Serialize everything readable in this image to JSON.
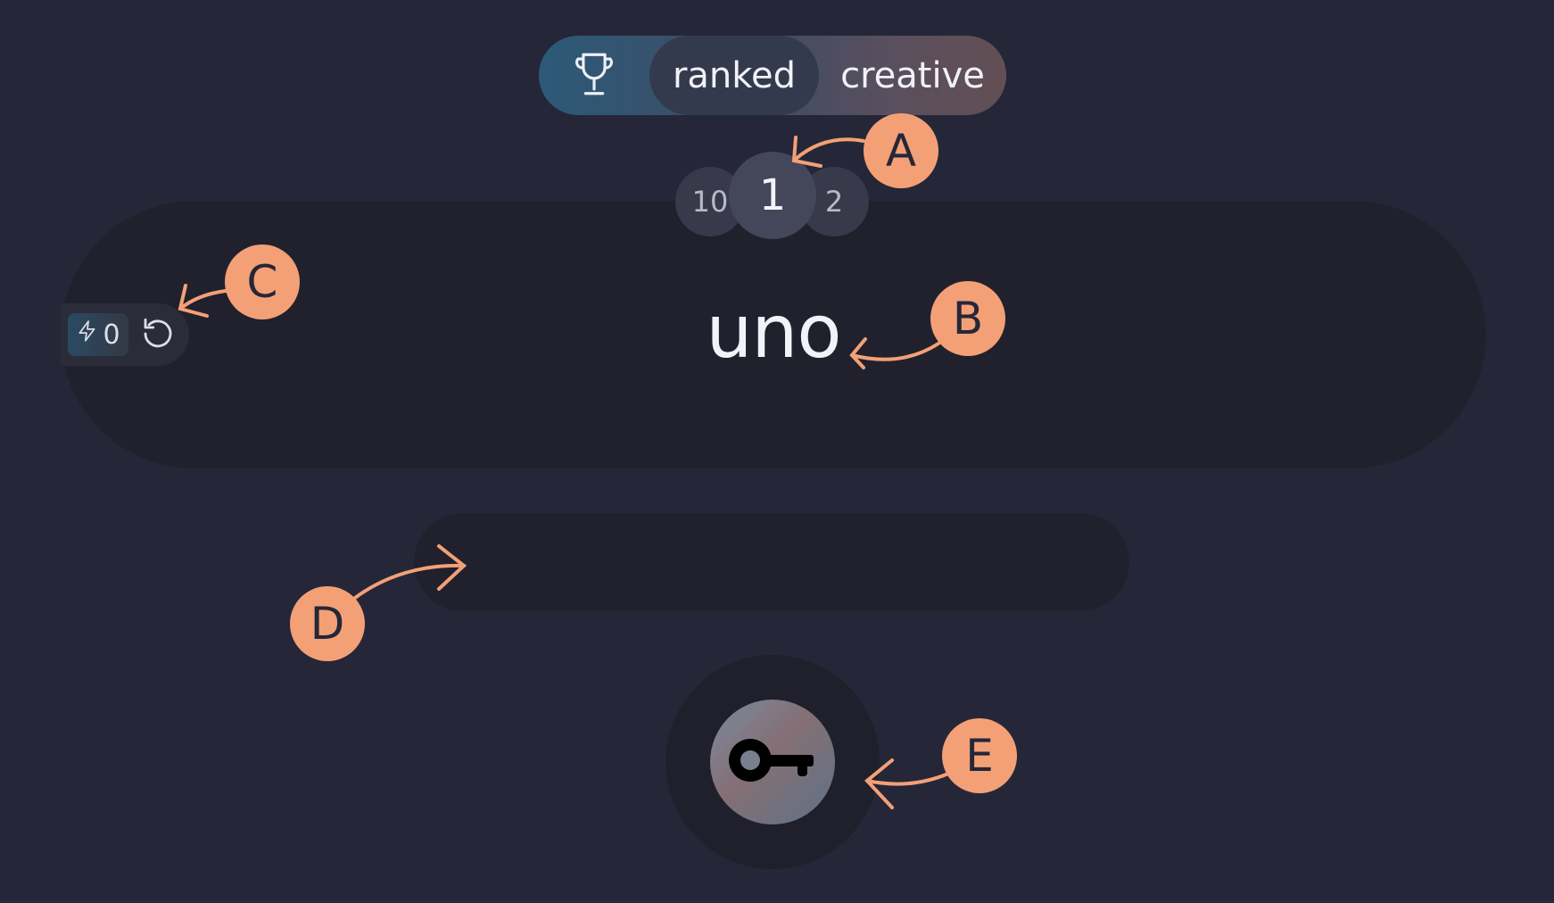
{
  "mode_switch": {
    "trophy_icon": "trophy-icon",
    "tabs": [
      {
        "label": "ranked",
        "active": true
      },
      {
        "label": "creative",
        "active": false
      }
    ]
  },
  "number_selector": {
    "previous": "10",
    "current": "1",
    "next": "2"
  },
  "word_card": {
    "word": "uno"
  },
  "streak": {
    "icon": "bolt-icon",
    "count": "0"
  },
  "reset": {
    "icon": "reset-icon"
  },
  "answer_input": {
    "value": "",
    "placeholder": ""
  },
  "key_button": {
    "icon": "key-icon"
  },
  "annotations": [
    "A",
    "B",
    "C",
    "D",
    "E"
  ],
  "colors": {
    "background": "#252738",
    "card": "#20212d",
    "annotation": "#f4a077"
  }
}
